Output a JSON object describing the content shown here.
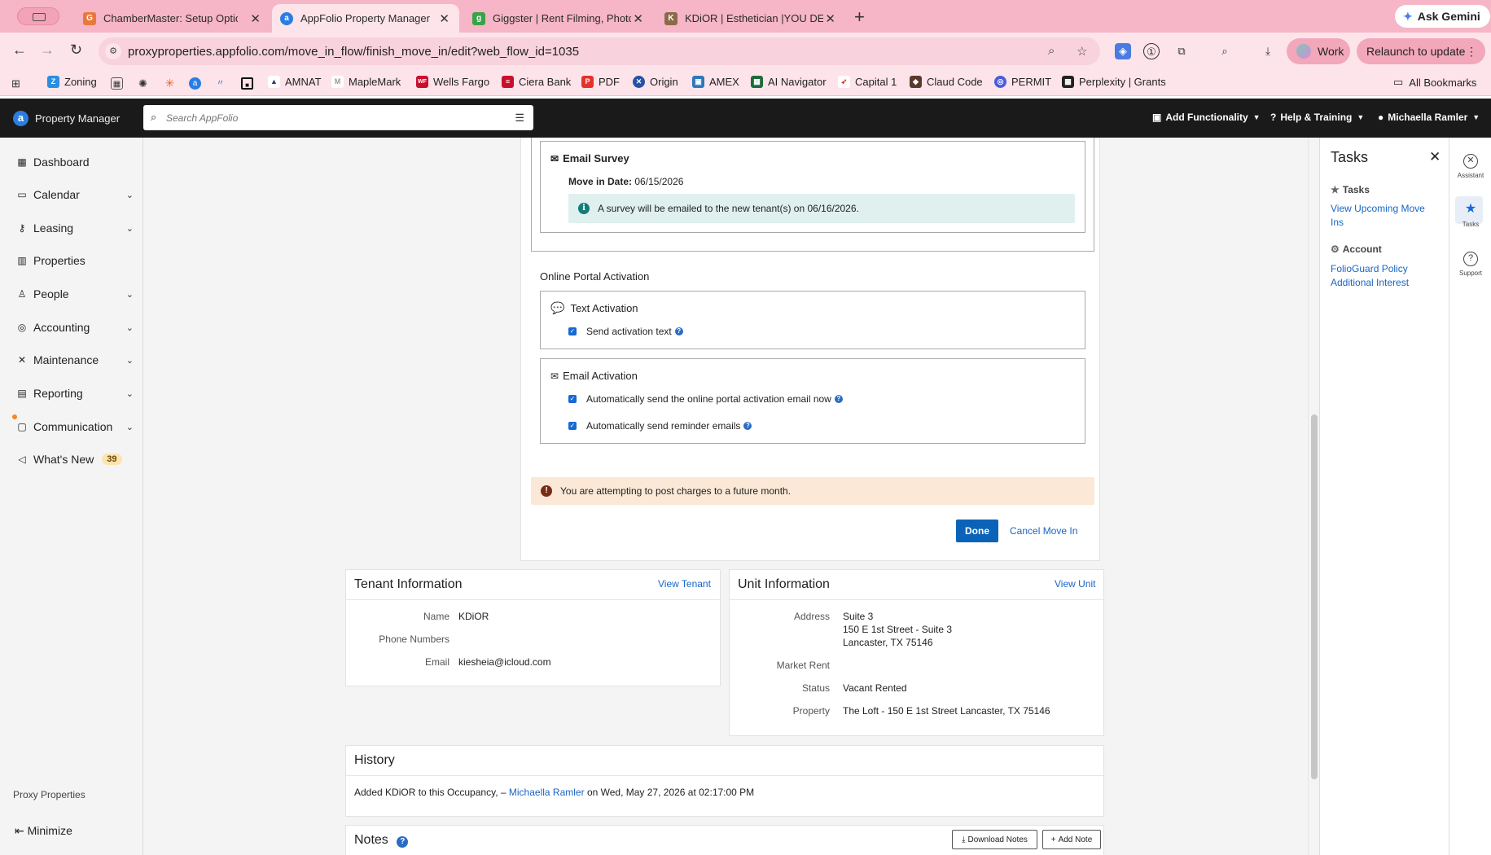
{
  "browser": {
    "tabs": [
      {
        "title": "ChamberMaster: Setup Optio",
        "fav_color": "#e8793a",
        "fav_glyph": "G"
      },
      {
        "title": "AppFolio Property Manager",
        "fav_color": "#2a7de1",
        "fav_glyph": "a"
      },
      {
        "title": "Giggster | Rent Filming, Photo",
        "fav_color": "#3aa24a",
        "fav_glyph": "g"
      },
      {
        "title": "KDiOR | Esthetician |YOU DEF",
        "fav_color": "#8a6a4a",
        "fav_glyph": "K"
      }
    ],
    "gemini_label": "Ask Gemini",
    "url": "proxyproperties.appfolio.com/move_in_flow/finish_move_in/edit?web_flow_id=1035",
    "work_label": "Work",
    "relaunch_label": "Relaunch to update",
    "bookmarks": [
      {
        "label": "Zoning",
        "color": "#2a8fe0",
        "glyph": "Z"
      },
      {
        "label": "AMNAT",
        "color": "#2a3a6a",
        "glyph": "A"
      },
      {
        "label": "MapleMark",
        "color": "#bbbbbb",
        "glyph": "M"
      },
      {
        "label": "Wells Fargo",
        "color": "#c8102e",
        "glyph": "WF"
      },
      {
        "label": "Ciera Bank",
        "color": "#c8102e",
        "glyph": "C"
      },
      {
        "label": "PDF",
        "color": "#e4312b",
        "glyph": "P"
      },
      {
        "label": "Origin",
        "color": "#2452a6",
        "glyph": "O"
      },
      {
        "label": "AMEX",
        "color": "#2e77bc",
        "glyph": "A"
      },
      {
        "label": "AI Navigator",
        "color": "#1f6b3a",
        "glyph": "N"
      },
      {
        "label": "Capital 1",
        "color": "#d03027",
        "glyph": "C"
      },
      {
        "label": "Claud Code",
        "color": "#5a3a2a",
        "glyph": "C"
      },
      {
        "label": "PERMIT",
        "color": "#4a5ae0",
        "glyph": "P"
      },
      {
        "label": "Perplexity | Grants",
        "color": "#222222",
        "glyph": "P"
      }
    ],
    "all_bookmarks_label": "All Bookmarks"
  },
  "header": {
    "brand": "Property Manager",
    "search_placeholder": "Search AppFolio",
    "add_functionality": "Add Functionality",
    "help_training": "Help & Training",
    "user": "Michaella Ramler"
  },
  "sidebar": {
    "items": [
      {
        "label": "Dashboard",
        "icon": "dashboard-icon",
        "glyph": "▦",
        "chevron": false
      },
      {
        "label": "Calendar",
        "icon": "calendar-icon",
        "glyph": "▭",
        "chevron": true
      },
      {
        "label": "Leasing",
        "icon": "key-icon",
        "glyph": "⚷",
        "chevron": true
      },
      {
        "label": "Properties",
        "icon": "building-icon",
        "glyph": "▥",
        "chevron": false
      },
      {
        "label": "People",
        "icon": "person-icon",
        "glyph": "♙",
        "chevron": true
      },
      {
        "label": "Accounting",
        "icon": "accounting-icon",
        "glyph": "◎",
        "chevron": true
      },
      {
        "label": "Maintenance",
        "icon": "tools-icon",
        "glyph": "✕",
        "chevron": true
      },
      {
        "label": "Reporting",
        "icon": "table-icon",
        "glyph": "▤",
        "chevron": true
      },
      {
        "label": "Communication",
        "icon": "chat-icon",
        "glyph": "▢",
        "chevron": true
      },
      {
        "label": "What's New",
        "icon": "megaphone-icon",
        "glyph": "◁",
        "chevron": false,
        "badge": "39"
      }
    ],
    "company": "Proxy Properties",
    "minimize": "Minimize"
  },
  "flow": {
    "email_survey_title": "Email Survey",
    "move_in_date_label": "Move in Date:",
    "move_in_date_value": "06/15/2026",
    "survey_alert": "A survey will be emailed to the new tenant(s) on 06/16/2026.",
    "portal_heading": "Online Portal Activation",
    "text_activation_title": "Text Activation",
    "send_activation_text": "Send activation text",
    "email_activation_title": "Email Activation",
    "auto_send_email": "Automatically send the online portal activation email now",
    "auto_send_reminder": "Automatically send reminder emails",
    "warning": "You are attempting to post charges to a future month.",
    "done_label": "Done",
    "cancel_label": "Cancel Move In"
  },
  "tenant": {
    "title": "Tenant Information",
    "view_link": "View Tenant",
    "name_label": "Name",
    "name_value": "KDiOR",
    "phone_label": "Phone Numbers",
    "email_label": "Email",
    "email_value": "kiesheia@icloud.com"
  },
  "unit": {
    "title": "Unit Information",
    "view_link": "View Unit",
    "address_label": "Address",
    "address_line1": "Suite 3",
    "address_line2": "150 E 1st Street - Suite 3",
    "address_line3": "Lancaster, TX 75146",
    "market_rent_label": "Market Rent",
    "status_label": "Status",
    "status_value": "Vacant Rented",
    "property_label": "Property",
    "property_value": "The Loft - 150 E 1st Street Lancaster, TX 75146"
  },
  "history": {
    "title": "History",
    "entry_prefix": "Added KDiOR to this Occupancy, –",
    "entry_user": "Michaella Ramler",
    "entry_suffix": "on Wed, May 27, 2026 at 02:17:00 PM"
  },
  "notes": {
    "title": "Notes",
    "download_label": "Download Notes",
    "add_label": "Add Note"
  },
  "tasks": {
    "title": "Tasks",
    "tasks_heading": "Tasks",
    "tasks_link": "View Upcoming Move Ins",
    "account_heading": "Account",
    "account_link": "FolioGuard Policy Additional Interest"
  },
  "rail": {
    "assistant": "Assistant",
    "tasks": "Tasks",
    "support": "Support"
  }
}
